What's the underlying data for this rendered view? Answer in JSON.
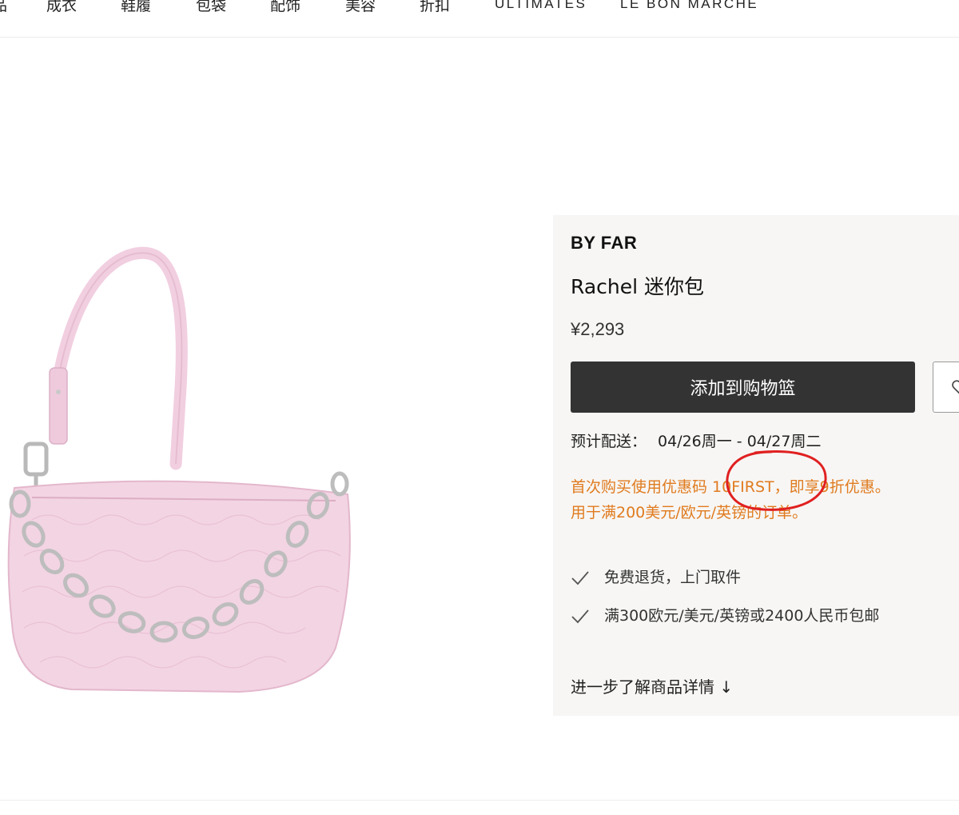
{
  "nav": {
    "items": [
      "品",
      "成衣",
      "鞋履",
      "包袋",
      "配饰",
      "美容",
      "折扣",
      "ULTIMATES",
      "LE BON MARCHÉ"
    ]
  },
  "product": {
    "brand": "BY FAR",
    "name": "Rachel 迷你包",
    "price": "¥2,293",
    "add_to_bag": "添加到购物篮",
    "delivery_label": "预计配送：",
    "delivery_dates": "04/26周一 - 04/27周二",
    "promo_line1": "首次购买使用优惠码 10FIRST，即享9折优惠。",
    "promo_line2": "用于满200美元/欧元/英镑的订单。",
    "features": [
      "免费退货，上门取件",
      "满300欧元/美元/英镑或2400人民币包邮"
    ],
    "details_link": "进一步了解商品详情 ↓"
  },
  "colors": {
    "promo": "#e07b1f",
    "button": "#333333",
    "panel_bg": "#f7f6f4",
    "annotation": "#e02020",
    "bag_pink": "#f2d3e2"
  },
  "icons": [
    "heart-icon",
    "check-icon",
    "arrow-down-icon"
  ]
}
